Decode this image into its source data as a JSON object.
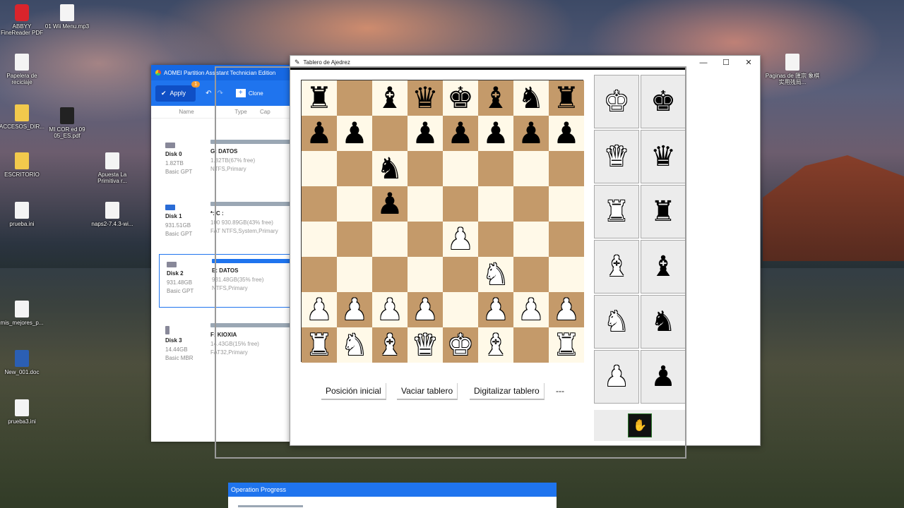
{
  "desktop_icons": [
    {
      "label": "ABBYY FineReader PDF",
      "icon": "abbyy-icon"
    },
    {
      "label": "01 Wii Menu.mp3",
      "icon": "audio-file-icon"
    },
    {
      "label": "Papelera de reciclaje",
      "icon": "recycle-bin-icon"
    },
    {
      "label": "ACCESOS_DIR...",
      "icon": "shortcut-folder-icon"
    },
    {
      "label": "MI COR ed 09 05_ES.pdf",
      "icon": "pdf-file-icon"
    },
    {
      "label": "ESCRITORIO",
      "icon": "folder-icon"
    },
    {
      "label": "Apuesta La Primitiva r...",
      "icon": "document-icon"
    },
    {
      "label": "prueba.ini",
      "icon": "ini-file-icon"
    },
    {
      "label": "naps2-7.4.3-wi...",
      "icon": "installer-icon"
    },
    {
      "label": "mis_mejores_p...",
      "icon": "document-icon"
    },
    {
      "label": "New_001.doc",
      "icon": "word-file-icon"
    },
    {
      "label": "prueba3.ini",
      "icon": "ini-file-icon"
    },
    {
      "label": "Paginas de 匯宗 象棋实用残局...",
      "icon": "document-icon"
    }
  ],
  "aomei": {
    "title": "AOMEI Partition Assistant Technician Edition",
    "apply_label": "Apply",
    "apply_badge": "1",
    "clone_label": "Clone",
    "col_name": "Name",
    "col_type": "Type",
    "col_cap": "Cap",
    "disks": [
      {
        "name": "Disk 0",
        "size": "1.82TB",
        "style": "Basic GPT",
        "partition": "G: DATOS",
        "info1": "1.82TB(67% free)",
        "info2": "NTFS,Primary"
      },
      {
        "name": "Disk 1",
        "size": "931.51GB",
        "style": "Basic GPT",
        "partition": "*:    C :",
        "info1": "100  930.89GB(43% free)",
        "info2": "FAT   NTFS,System,Primary"
      },
      {
        "name": "Disk 2",
        "size": "931.48GB",
        "style": "Basic GPT",
        "partition": "E: DATOS",
        "info1": "931.48GB(35% free)",
        "info2": "NTFS,Primary"
      },
      {
        "name": "Disk 3",
        "size": "14.44GB",
        "style": "Basic MBR",
        "partition": "F: KIOXIA",
        "info1": "14.43GB(15% free)",
        "info2": "FAT32,Primary"
      }
    ]
  },
  "chess": {
    "title": "Tablero de Ajedrez",
    "rows": [
      [
        "r",
        "",
        "b",
        "q",
        "k",
        "b",
        "n",
        "r"
      ],
      [
        "p",
        "p",
        "",
        "p",
        "p",
        "p",
        "p",
        "p"
      ],
      [
        "",
        "",
        "n",
        "",
        "",
        "",
        "",
        ""
      ],
      [
        "",
        "",
        "p",
        "",
        "",
        "",
        "",
        ""
      ],
      [
        "",
        "",
        "",
        "",
        "P",
        "",
        "",
        ""
      ],
      [
        "",
        "",
        "",
        "",
        "",
        "N",
        "",
        ""
      ],
      [
        "P",
        "P",
        "P",
        "P",
        "",
        "P",
        "P",
        "P"
      ],
      [
        "R",
        "N",
        "B",
        "Q",
        "K",
        "B",
        "",
        "R"
      ]
    ],
    "buttons": {
      "initial": "Posición inicial",
      "clear": "Vaciar tablero",
      "digitize": "Digitalizar tablero"
    },
    "status": "---",
    "palette": [
      {
        "white": "K",
        "black": "k"
      },
      {
        "white": "Q",
        "black": "q"
      },
      {
        "white": "R",
        "black": "r"
      },
      {
        "white": "B",
        "black": "b"
      },
      {
        "white": "N",
        "black": "n"
      },
      {
        "white": "P",
        "black": "p"
      }
    ],
    "colors": {
      "light": "#fff9e8",
      "dark": "#c49a6a"
    }
  },
  "operation_progress": {
    "title": "Operation Progress"
  }
}
